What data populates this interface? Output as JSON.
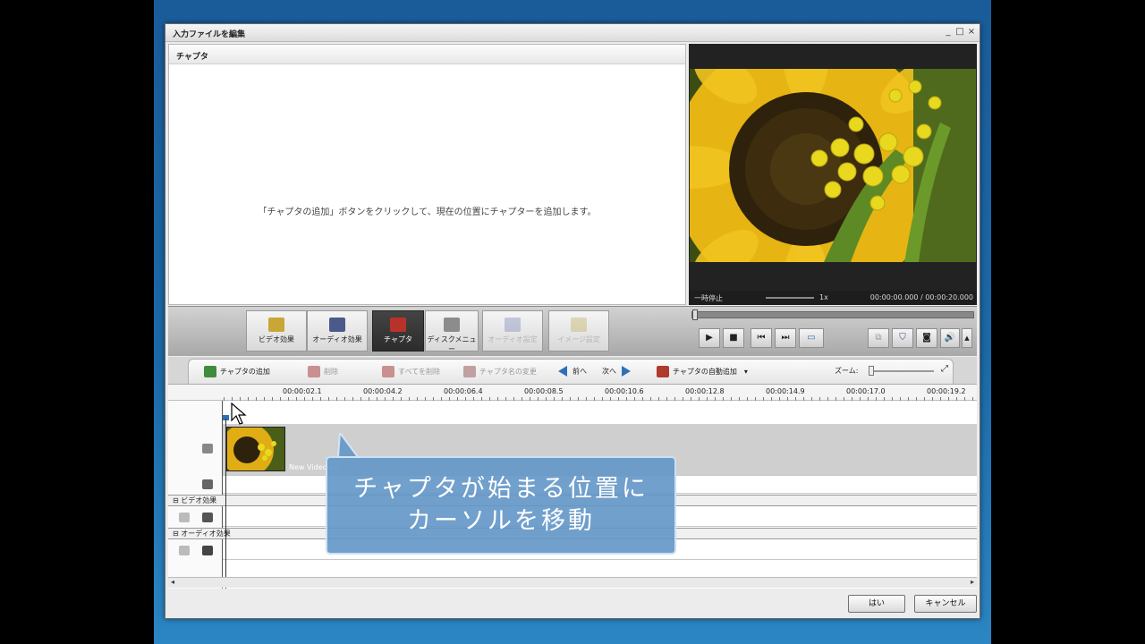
{
  "window": {
    "title": "入力ファイルを編集",
    "controls": [
      "_",
      "□",
      "×"
    ]
  },
  "chapter_panel": {
    "header": "チャプタ",
    "message": "「チャプタの追加」ボタンをクリックして、現在の位置にチャプターを追加します。"
  },
  "preview": {
    "state": "一時停止",
    "speed": "1x",
    "time": "00:00:00.000 / 00:00:20.000"
  },
  "tools": [
    {
      "label": "ビデオ効果",
      "state": "normal",
      "icon": "video-effect-icon"
    },
    {
      "label": "オーディオ効果",
      "state": "normal",
      "icon": "audio-effect-icon"
    },
    {
      "label": "チャプタ",
      "state": "active",
      "icon": "chapter-icon"
    },
    {
      "label": "ディスクメニュー",
      "state": "normal",
      "icon": "disc-menu-icon"
    },
    {
      "label": "オーディオ設定",
      "state": "disabled",
      "icon": "audio-settings-icon"
    },
    {
      "label": "イメージ設定",
      "state": "disabled",
      "icon": "image-settings-icon"
    }
  ],
  "chapter_toolbar": {
    "add": "チャプタの追加",
    "delete": "削除",
    "delete_all": "すべてを削除",
    "rename": "チャプタ名の変更",
    "prev": "前へ",
    "next": "次へ",
    "auto_add": "チャプタの自動追加",
    "zoom": "ズーム:"
  },
  "ruler": [
    "00:00:02.1",
    "00:00:04.2",
    "00:00:06.4",
    "00:00:08.5",
    "00:00:10.6",
    "00:00:12.8",
    "00:00:14.9",
    "00:00:17.0",
    "00:00:19.2"
  ],
  "tracks": {
    "video_effects": "ビデオ効果",
    "audio_effects": "オーディオ効果",
    "clip_label": "New Video.avi"
  },
  "buttons": {
    "ok": "はい",
    "cancel": "キャンセル"
  },
  "callout": {
    "line1": "チャプタが始まる位置に",
    "line2": "カーソルを移動"
  },
  "colors": {
    "accent": "#2e6fb8",
    "callout_bg": "#6296c6",
    "desktop": "#1b6aa8"
  }
}
